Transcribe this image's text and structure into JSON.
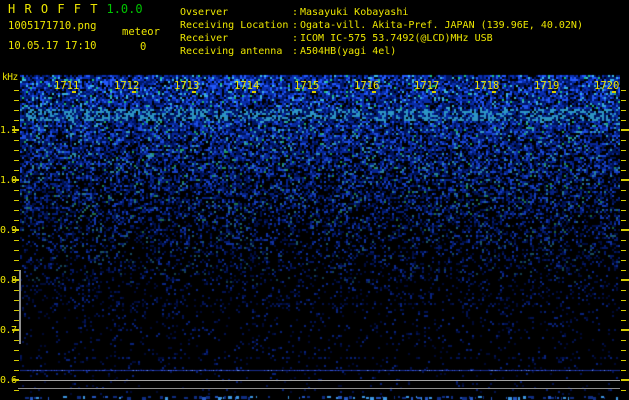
{
  "app": {
    "title": "H R O F F T",
    "version": "1.0.0",
    "filename": "1005171710.png",
    "mode": "meteor",
    "datetime": "10.05.17 17:10",
    "count": "0"
  },
  "info": {
    "separator": ":",
    "rows": [
      {
        "label": "Ovserver",
        "value": "Masayuki Kobayashi"
      },
      {
        "label": "Receiving Location",
        "value": "Ogata-vill. Akita-Pref. JAPAN (139.96E, 40.02N)"
      },
      {
        "label": "Receiver",
        "value": "ICOM IC-575 53.7492(@LCD)MHz USB"
      },
      {
        "label": "Receiving antenna",
        "value": "A504HB(yagi 4el)"
      }
    ]
  },
  "spectrogram": {
    "y_axis": {
      "unit": "kHz",
      "labels": [
        "1.1",
        "1.0",
        "0.9",
        "0.8",
        "0.7",
        "0.6"
      ]
    },
    "x_axis": {
      "labels": [
        "1711",
        "1712",
        "1713",
        "1714",
        "1715",
        "1716",
        "1717",
        "1718",
        "1719",
        "1720"
      ]
    },
    "colors": {
      "text_yellow": "#ece600",
      "version_green": "#00c400",
      "noise_bright_blue": "#2a52ff",
      "noise_cyan": "#39d7e8",
      "noise_green": "#1ec864",
      "carrier_blue": "#2e4fd8",
      "grid_gray": "#9a9a9a"
    }
  }
}
